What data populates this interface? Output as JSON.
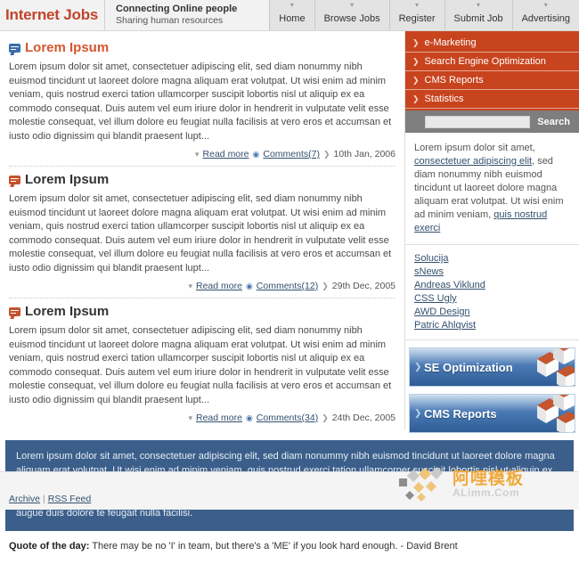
{
  "header": {
    "logo": "Internet Jobs",
    "tagline_main": "Connecting Online people",
    "tagline_sub": "Sharing human resources",
    "nav": [
      {
        "label": "Home"
      },
      {
        "label": "Browse Jobs"
      },
      {
        "label": "Register"
      },
      {
        "label": "Submit Job"
      },
      {
        "label": "Advertising"
      }
    ],
    "nav_icon": "chevron-down-icon"
  },
  "posts": [
    {
      "title": "Lorem Ipsum",
      "body": "Lorem ipsum dolor sit amet, consectetuer adipiscing elit, sed diam nonummy nibh euismod tincidunt ut laoreet dolore magna aliquam erat volutpat. Ut wisi enim ad minim veniam, quis nostrud exerci tation ullamcorper suscipit lobortis nisl ut aliquip ex ea commodo consequat. Duis autem vel eum iriure dolor in hendrerit in vulputate velit esse molestie consequat, vel illum dolore eu feugiat nulla facilisis at vero eros et accumsan et iusto odio dignissim qui blandit praesent lupt...",
      "read_more": "Read more",
      "comments": "Comments(7)",
      "date": "10th Jan, 2006"
    },
    {
      "title": "Lorem Ipsum",
      "body": "Lorem ipsum dolor sit amet, consectetuer adipiscing elit, sed diam nonummy nibh euismod tincidunt ut laoreet dolore magna aliquam erat volutpat. Ut wisi enim ad minim veniam, quis nostrud exerci tation ullamcorper suscipit lobortis nisl ut aliquip ex ea commodo consequat. Duis autem vel eum iriure dolor in hendrerit in vulputate velit esse molestie consequat, vel illum dolore eu feugiat nulla facilisis at vero eros et accumsan et iusto odio dignissim qui blandit praesent lupt...",
      "read_more": "Read more",
      "comments": "Comments(12)",
      "date": "29th Dec, 2005"
    },
    {
      "title": "Lorem Ipsum",
      "body": "Lorem ipsum dolor sit amet, consectetuer adipiscing elit, sed diam nonummy nibh euismod tincidunt ut laoreet dolore magna aliquam erat volutpat. Ut wisi enim ad minim veniam, quis nostrud exerci tation ullamcorper suscipit lobortis nisl ut aliquip ex ea commodo consequat. Duis autem vel eum iriure dolor in hendrerit in vulputate velit esse molestie consequat, vel illum dolore eu feugiat nulla facilisis at vero eros et accumsan et iusto odio dignissim qui blandit praesent lupt...",
      "read_more": "Read more",
      "comments": "Comments(34)",
      "date": "24th Dec, 2005"
    }
  ],
  "sidebar": {
    "menu": [
      {
        "label": "e-Marketing"
      },
      {
        "label": "Search Engine Optimization"
      },
      {
        "label": "CMS Reports"
      },
      {
        "label": "Statistics"
      }
    ],
    "menu_icon": "chevron-right-icon",
    "search": {
      "value": "",
      "placeholder": "",
      "button": "Search"
    },
    "about": {
      "part1": "Lorem ipsum dolor sit amet, ",
      "link1": "consectetuer adipiscing elit",
      "part2": ", sed diam nonummy nibh euismod tincidunt ut laoreet dolore magna aliquam erat volutpat. Ut wisi enim ad minim veniam, ",
      "link2": "quis nostrud exerci"
    },
    "links": [
      {
        "label": "Solucija"
      },
      {
        "label": "sNews"
      },
      {
        "label": "Andreas Viklund"
      },
      {
        "label": "CSS Ugly"
      },
      {
        "label": "AWD Design"
      },
      {
        "label": "Patric Ahlqvist"
      }
    ],
    "banners": [
      {
        "label": "SE Optimization"
      },
      {
        "label": "CMS Reports"
      }
    ]
  },
  "infobox": {
    "text": "Lorem ipsum dolor sit amet, consectetuer adipiscing elit, sed diam nonummy nibh euismod tincidunt ut laoreet dolore magna aliquam erat volutpat. Ut wisi enim ad minim veniam, quis nostrud exerci tation ullamcorper suscipit lobortis nisl ut aliquip ex ea commodo consequat. Duis autem vel eum iriure dolor in hendrerit in vulputate velit esse molestie consequat, vel illum dolore eu feugiat nulla facilisis at vero eros et accumsan et iusto odio dignissim qui blandit praesent luptatum zzril delenit augue duis dolore te feugait nulla facilisi."
  },
  "quote": {
    "label": "Quote of the day:",
    "text": " There may be no 'I' in team, but there's a 'ME' if you look hard enough. - David Brent"
  },
  "footer": {
    "archive": "Archive",
    "separator": "|",
    "rss": "RSS Feed",
    "watermark_cn": "阿哩模板",
    "watermark_en": "ALimm.Com"
  },
  "colors": {
    "brand_orange": "#c8441f",
    "logo_red": "#c0452a",
    "link_blue": "#33506e",
    "infobox_blue": "#3b5f8a",
    "banner_blue": "#2f5d96"
  }
}
